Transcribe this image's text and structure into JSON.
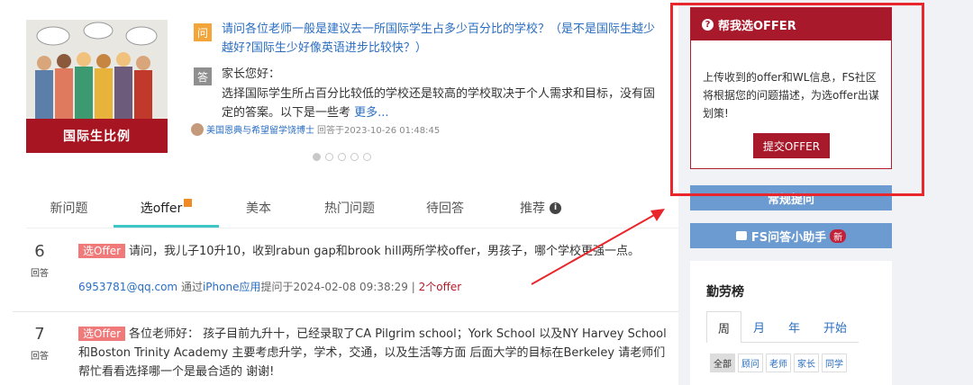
{
  "featured": {
    "image_banner": "国际生比例",
    "q_tag": "问",
    "question": "请问各位老师一般是建议去一所国际学生占多少百分比的学校？（是不是国际生越少越好?国际生少好像英语进步比较快？）",
    "a_tag": "答",
    "answer_greeting": "家长您好：",
    "answer_text": "选择国际学生所占百分比较低的学校还是较高的学校取决于个人需求和目标，没有固定的答案。以下是一些考",
    "more_label": "更多...",
    "author": "美国恩典与希望留学饶博士",
    "answered_at": "回答于2023-10-26 01:48:45"
  },
  "carousel": {
    "count": 5,
    "active": 0
  },
  "tabs": [
    {
      "label": "新问题"
    },
    {
      "label": "选offer"
    },
    {
      "label": "美本"
    },
    {
      "label": "热门问题"
    },
    {
      "label": "待回答"
    },
    {
      "label": "推荐"
    }
  ],
  "questions": [
    {
      "count": "6",
      "count_label": "回答",
      "badge": "选Offer",
      "text": "请问，我儿子10升10，收到rabun gap和brook hill两所学校offer，男孩子，哪个学校更强一点。",
      "user": "6953781@qq.com",
      "via_prefix": " 通过",
      "via": "iPhone应用",
      "asked": "提问于2024-02-08 09:38:29",
      "sep": " | ",
      "offers": "2个offer"
    },
    {
      "count": "7",
      "count_label": "回答",
      "badge": "选Offer",
      "text": "各位老师好： 孩子目前九升十，已经录取了CA Pilgrim school；York School 以及NY Harvey School和Boston Trinity Academy 主要考虑升学，学术，交通，以及生活等方面 后面大学的目标在Berkeley 请老师们帮忙看看选择哪一个是最合适的 谢谢!"
    }
  ],
  "sidebar": {
    "offer_card": {
      "title": "帮我选OFFER",
      "description": "上传收到的offer和WL信息，FS社区将根据您的问题描述，为选offer出谋划策!",
      "button": "提交OFFER"
    },
    "regular_question_button": "常规提问",
    "assistant_button": "FS问答小助手",
    "assistant_badge": "新",
    "rank": {
      "title": "勤劳榜",
      "periods": [
        "周",
        "月",
        "年",
        "开始"
      ],
      "filters": [
        "全部",
        "顾问",
        "老师",
        "家长",
        "同学"
      ]
    }
  },
  "colors": {
    "brand_red": "#a8192b",
    "link_blue": "#2a6ec1",
    "tab_underline": "#3ec6c6",
    "annotation_red": "#e8262b",
    "side_button_blue": "#6c9bd1"
  }
}
